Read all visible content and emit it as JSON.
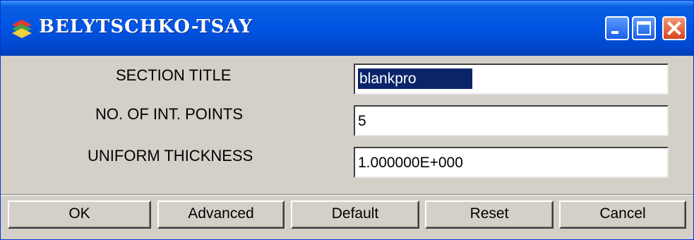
{
  "window": {
    "title": "BELYTSCHKO-TSAY"
  },
  "fields": [
    {
      "label": "SECTION TITLE",
      "value": "blankpro"
    },
    {
      "label": "NO. OF INT. POINTS",
      "value": "5"
    },
    {
      "label": "UNIFORM THICKNESS",
      "value": "1.000000E+000"
    }
  ],
  "buttons": {
    "ok": "OK",
    "advanced": "Advanced",
    "default": "Default",
    "reset": "Reset",
    "cancel": "Cancel"
  },
  "colors": {
    "title_bar": "#0054e3",
    "dialog_bg": "#d4d0c8",
    "selection": "#0a246a",
    "close_button": "#d9441d"
  }
}
